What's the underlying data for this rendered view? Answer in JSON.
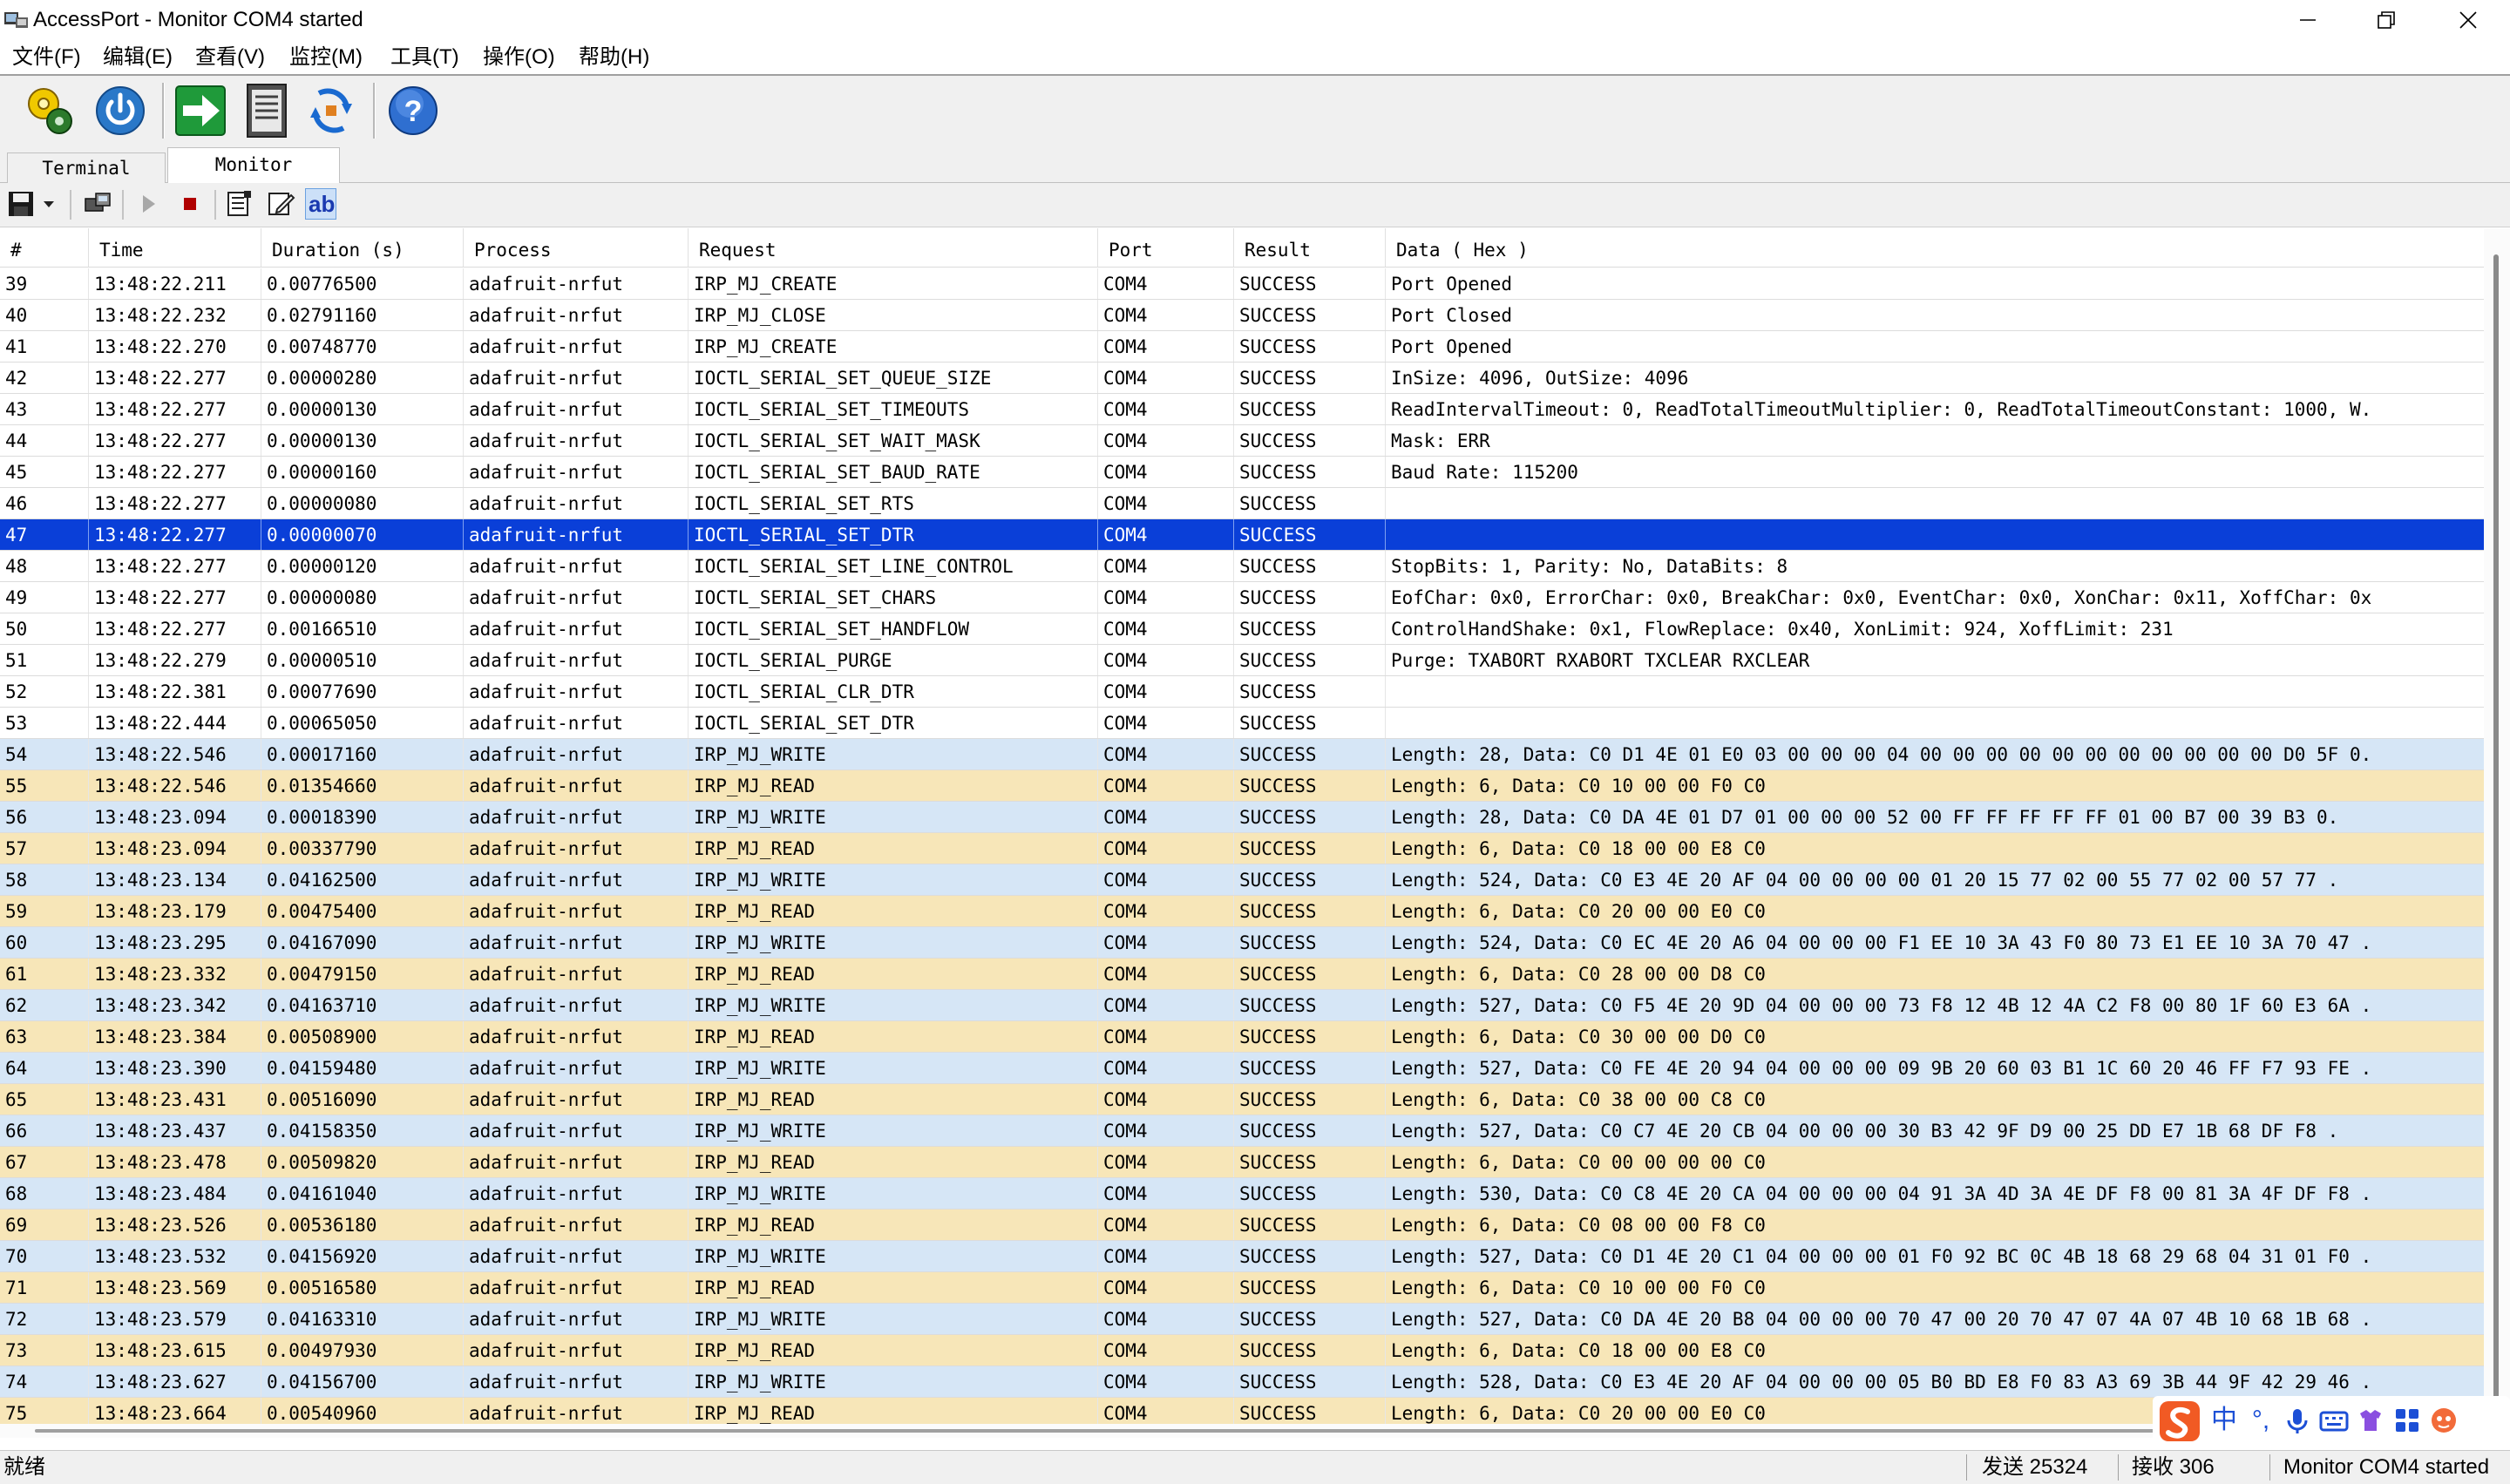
{
  "window": {
    "title": "AccessPort - Monitor COM4 started"
  },
  "menu": [
    "文件(F)",
    "编辑(E)",
    "查看(V)",
    "监控(M)",
    "工具(T)",
    "操作(O)",
    "帮助(H)"
  ],
  "tabs": {
    "terminal": "Terminal",
    "monitor": "Monitor"
  },
  "toolbar2": {
    "highlight_label": "ab"
  },
  "columns": [
    "#",
    "Time",
    "Duration (s)",
    "Process",
    "Request",
    "Port",
    "Result",
    "Data ( Hex )"
  ],
  "rows": [
    {
      "n": "39",
      "time": "13:48:22.211",
      "dur": "0.00776500",
      "proc": "adafruit-nrfut",
      "req": "IRP_MJ_CREATE",
      "port": "COM4",
      "res": "SUCCESS",
      "data": "Port Opened",
      "kind": "plain"
    },
    {
      "n": "40",
      "time": "13:48:22.232",
      "dur": "0.02791160",
      "proc": "adafruit-nrfut",
      "req": "IRP_MJ_CLOSE",
      "port": "COM4",
      "res": "SUCCESS",
      "data": "Port Closed",
      "kind": "plain"
    },
    {
      "n": "41",
      "time": "13:48:22.270",
      "dur": "0.00748770",
      "proc": "adafruit-nrfut",
      "req": "IRP_MJ_CREATE",
      "port": "COM4",
      "res": "SUCCESS",
      "data": "Port Opened",
      "kind": "plain"
    },
    {
      "n": "42",
      "time": "13:48:22.277",
      "dur": "0.00000280",
      "proc": "adafruit-nrfut",
      "req": "IOCTL_SERIAL_SET_QUEUE_SIZE",
      "port": "COM4",
      "res": "SUCCESS",
      "data": "InSize: 4096, OutSize: 4096",
      "kind": "plain"
    },
    {
      "n": "43",
      "time": "13:48:22.277",
      "dur": "0.00000130",
      "proc": "adafruit-nrfut",
      "req": "IOCTL_SERIAL_SET_TIMEOUTS",
      "port": "COM4",
      "res": "SUCCESS",
      "data": "ReadIntervalTimeout: 0, ReadTotalTimeoutMultiplier: 0, ReadTotalTimeoutConstant: 1000, W.",
      "kind": "plain"
    },
    {
      "n": "44",
      "time": "13:48:22.277",
      "dur": "0.00000130",
      "proc": "adafruit-nrfut",
      "req": "IOCTL_SERIAL_SET_WAIT_MASK",
      "port": "COM4",
      "res": "SUCCESS",
      "data": "Mask: ERR",
      "kind": "plain"
    },
    {
      "n": "45",
      "time": "13:48:22.277",
      "dur": "0.00000160",
      "proc": "adafruit-nrfut",
      "req": "IOCTL_SERIAL_SET_BAUD_RATE",
      "port": "COM4",
      "res": "SUCCESS",
      "data": "Baud Rate: 115200",
      "kind": "plain"
    },
    {
      "n": "46",
      "time": "13:48:22.277",
      "dur": "0.00000080",
      "proc": "adafruit-nrfut",
      "req": "IOCTL_SERIAL_SET_RTS",
      "port": "COM4",
      "res": "SUCCESS",
      "data": "",
      "kind": "plain"
    },
    {
      "n": "47",
      "time": "13:48:22.277",
      "dur": "0.00000070",
      "proc": "adafruit-nrfut",
      "req": "IOCTL_SERIAL_SET_DTR",
      "port": "COM4",
      "res": "SUCCESS",
      "data": "",
      "kind": "selected"
    },
    {
      "n": "48",
      "time": "13:48:22.277",
      "dur": "0.00000120",
      "proc": "adafruit-nrfut",
      "req": "IOCTL_SERIAL_SET_LINE_CONTROL",
      "port": "COM4",
      "res": "SUCCESS",
      "data": "StopBits: 1, Parity: No, DataBits: 8",
      "kind": "plain"
    },
    {
      "n": "49",
      "time": "13:48:22.277",
      "dur": "0.00000080",
      "proc": "adafruit-nrfut",
      "req": "IOCTL_SERIAL_SET_CHARS",
      "port": "COM4",
      "res": "SUCCESS",
      "data": "EofChar: 0x0, ErrorChar: 0x0, BreakChar: 0x0, EventChar: 0x0, XonChar: 0x11, XoffChar: 0x",
      "kind": "plain"
    },
    {
      "n": "50",
      "time": "13:48:22.277",
      "dur": "0.00166510",
      "proc": "adafruit-nrfut",
      "req": "IOCTL_SERIAL_SET_HANDFLOW",
      "port": "COM4",
      "res": "SUCCESS",
      "data": "ControlHandShake: 0x1, FlowReplace: 0x40, XonLimit: 924, XoffLimit: 231",
      "kind": "plain"
    },
    {
      "n": "51",
      "time": "13:48:22.279",
      "dur": "0.00000510",
      "proc": "adafruit-nrfut",
      "req": "IOCTL_SERIAL_PURGE",
      "port": "COM4",
      "res": "SUCCESS",
      "data": "Purge: TXABORT RXABORT TXCLEAR RXCLEAR",
      "kind": "plain"
    },
    {
      "n": "52",
      "time": "13:48:22.381",
      "dur": "0.00077690",
      "proc": "adafruit-nrfut",
      "req": "IOCTL_SERIAL_CLR_DTR",
      "port": "COM4",
      "res": "SUCCESS",
      "data": "",
      "kind": "plain"
    },
    {
      "n": "53",
      "time": "13:48:22.444",
      "dur": "0.00065050",
      "proc": "adafruit-nrfut",
      "req": "IOCTL_SERIAL_SET_DTR",
      "port": "COM4",
      "res": "SUCCESS",
      "data": "",
      "kind": "plain"
    },
    {
      "n": "54",
      "time": "13:48:22.546",
      "dur": "0.00017160",
      "proc": "adafruit-nrfut",
      "req": "IRP_MJ_WRITE",
      "port": "COM4",
      "res": "SUCCESS",
      "data": "Length: 28, Data: C0 D1 4E 01 E0 03 00 00 00 04 00 00 00 00 00 00 00 00 00 00 00 D0 5F 0.",
      "kind": "write"
    },
    {
      "n": "55",
      "time": "13:48:22.546",
      "dur": "0.01354660",
      "proc": "adafruit-nrfut",
      "req": "IRP_MJ_READ",
      "port": "COM4",
      "res": "SUCCESS",
      "data": "Length: 6, Data: C0 10 00 00 F0 C0",
      "kind": "read"
    },
    {
      "n": "56",
      "time": "13:48:23.094",
      "dur": "0.00018390",
      "proc": "adafruit-nrfut",
      "req": "IRP_MJ_WRITE",
      "port": "COM4",
      "res": "SUCCESS",
      "data": "Length: 28, Data: C0 DA 4E 01 D7 01 00 00 00 52 00 FF FF FF FF FF 01 00 B7 00 39 B3 0.",
      "kind": "write"
    },
    {
      "n": "57",
      "time": "13:48:23.094",
      "dur": "0.00337790",
      "proc": "adafruit-nrfut",
      "req": "IRP_MJ_READ",
      "port": "COM4",
      "res": "SUCCESS",
      "data": "Length: 6, Data: C0 18 00 00 E8 C0",
      "kind": "read"
    },
    {
      "n": "58",
      "time": "13:48:23.134",
      "dur": "0.04162500",
      "proc": "adafruit-nrfut",
      "req": "IRP_MJ_WRITE",
      "port": "COM4",
      "res": "SUCCESS",
      "data": "Length: 524, Data: C0 E3 4E 20 AF 04 00 00 00 00 01 20 15 77 02 00 55 77 02 00 57 77 .",
      "kind": "write"
    },
    {
      "n": "59",
      "time": "13:48:23.179",
      "dur": "0.00475400",
      "proc": "adafruit-nrfut",
      "req": "IRP_MJ_READ",
      "port": "COM4",
      "res": "SUCCESS",
      "data": "Length: 6, Data: C0 20 00 00 E0 C0",
      "kind": "read"
    },
    {
      "n": "60",
      "time": "13:48:23.295",
      "dur": "0.04167090",
      "proc": "adafruit-nrfut",
      "req": "IRP_MJ_WRITE",
      "port": "COM4",
      "res": "SUCCESS",
      "data": "Length: 524, Data: C0 EC 4E 20 A6 04 00 00 00 F1 EE 10 3A 43 F0 80 73 E1 EE 10 3A 70 47 .",
      "kind": "write"
    },
    {
      "n": "61",
      "time": "13:48:23.332",
      "dur": "0.00479150",
      "proc": "adafruit-nrfut",
      "req": "IRP_MJ_READ",
      "port": "COM4",
      "res": "SUCCESS",
      "data": "Length: 6, Data: C0 28 00 00 D8 C0",
      "kind": "read"
    },
    {
      "n": "62",
      "time": "13:48:23.342",
      "dur": "0.04163710",
      "proc": "adafruit-nrfut",
      "req": "IRP_MJ_WRITE",
      "port": "COM4",
      "res": "SUCCESS",
      "data": "Length: 527, Data: C0 F5 4E 20 9D 04 00 00 00 73 F8 12 4B 12 4A C2 F8 00 80 1F 60 E3 6A .",
      "kind": "write"
    },
    {
      "n": "63",
      "time": "13:48:23.384",
      "dur": "0.00508900",
      "proc": "adafruit-nrfut",
      "req": "IRP_MJ_READ",
      "port": "COM4",
      "res": "SUCCESS",
      "data": "Length: 6, Data: C0 30 00 00 D0 C0",
      "kind": "read"
    },
    {
      "n": "64",
      "time": "13:48:23.390",
      "dur": "0.04159480",
      "proc": "adafruit-nrfut",
      "req": "IRP_MJ_WRITE",
      "port": "COM4",
      "res": "SUCCESS",
      "data": "Length: 527, Data: C0 FE 4E 20 94 04 00 00 00 09 9B 20 60 03 B1 1C 60 20 46 FF F7 93 FE .",
      "kind": "write"
    },
    {
      "n": "65",
      "time": "13:48:23.431",
      "dur": "0.00516090",
      "proc": "adafruit-nrfut",
      "req": "IRP_MJ_READ",
      "port": "COM4",
      "res": "SUCCESS",
      "data": "Length: 6, Data: C0 38 00 00 C8 C0",
      "kind": "read"
    },
    {
      "n": "66",
      "time": "13:48:23.437",
      "dur": "0.04158350",
      "proc": "adafruit-nrfut",
      "req": "IRP_MJ_WRITE",
      "port": "COM4",
      "res": "SUCCESS",
      "data": "Length: 527, Data: C0 C7 4E 20 CB 04 00 00 00 30 B3 42 9F D9 00 25 DD E7 1B 68 DF F8 .",
      "kind": "write"
    },
    {
      "n": "67",
      "time": "13:48:23.478",
      "dur": "0.00509820",
      "proc": "adafruit-nrfut",
      "req": "IRP_MJ_READ",
      "port": "COM4",
      "res": "SUCCESS",
      "data": "Length: 6, Data: C0 00 00 00 00 C0",
      "kind": "read"
    },
    {
      "n": "68",
      "time": "13:48:23.484",
      "dur": "0.04161040",
      "proc": "adafruit-nrfut",
      "req": "IRP_MJ_WRITE",
      "port": "COM4",
      "res": "SUCCESS",
      "data": "Length: 530, Data: C0 C8 4E 20 CA 04 00 00 00 04 91 3A 4D 3A 4E DF F8 00 81 3A 4F DF F8 .",
      "kind": "write"
    },
    {
      "n": "69",
      "time": "13:48:23.526",
      "dur": "0.00536180",
      "proc": "adafruit-nrfut",
      "req": "IRP_MJ_READ",
      "port": "COM4",
      "res": "SUCCESS",
      "data": "Length: 6, Data: C0 08 00 00 F8 C0",
      "kind": "read"
    },
    {
      "n": "70",
      "time": "13:48:23.532",
      "dur": "0.04156920",
      "proc": "adafruit-nrfut",
      "req": "IRP_MJ_WRITE",
      "port": "COM4",
      "res": "SUCCESS",
      "data": "Length: 527, Data: C0 D1 4E 20 C1 04 00 00 00 01 F0 92 BC 0C 4B 18 68 29 68 04 31 01 F0 .",
      "kind": "write"
    },
    {
      "n": "71",
      "time": "13:48:23.569",
      "dur": "0.00516580",
      "proc": "adafruit-nrfut",
      "req": "IRP_MJ_READ",
      "port": "COM4",
      "res": "SUCCESS",
      "data": "Length: 6, Data: C0 10 00 00 F0 C0",
      "kind": "read"
    },
    {
      "n": "72",
      "time": "13:48:23.579",
      "dur": "0.04163310",
      "proc": "adafruit-nrfut",
      "req": "IRP_MJ_WRITE",
      "port": "COM4",
      "res": "SUCCESS",
      "data": "Length: 527, Data: C0 DA 4E 20 B8 04 00 00 00 70 47 00 20 70 47 07 4A 07 4B 10 68 1B 68 .",
      "kind": "write"
    },
    {
      "n": "73",
      "time": "13:48:23.615",
      "dur": "0.00497930",
      "proc": "adafruit-nrfut",
      "req": "IRP_MJ_READ",
      "port": "COM4",
      "res": "SUCCESS",
      "data": "Length: 6, Data: C0 18 00 00 E8 C0",
      "kind": "read"
    },
    {
      "n": "74",
      "time": "13:48:23.627",
      "dur": "0.04156700",
      "proc": "adafruit-nrfut",
      "req": "IRP_MJ_WRITE",
      "port": "COM4",
      "res": "SUCCESS",
      "data": "Length: 528, Data: C0 E3 4E 20 AF 04 00 00 00 05 B0 BD E8 F0 83 A3 69 3B 44 9F 42 29 46 .",
      "kind": "write"
    },
    {
      "n": "75",
      "time": "13:48:23.664",
      "dur": "0.00540960",
      "proc": "adafruit-nrfut",
      "req": "IRP_MJ_READ",
      "port": "COM4",
      "res": "SUCCESS",
      "data": "Length: 6, Data: C0 20 00 00 E0 C0",
      "kind": "read"
    }
  ],
  "ime": [
    "中",
    "°,"
  ],
  "status": {
    "ready": "就绪",
    "sent": "发送 25324",
    "received": "接收 306",
    "state": "Monitor COM4 started"
  },
  "colors": {
    "selected": "#0a3fd8",
    "write_row": "#d6e6f6",
    "read_row": "#f7e6b8"
  }
}
